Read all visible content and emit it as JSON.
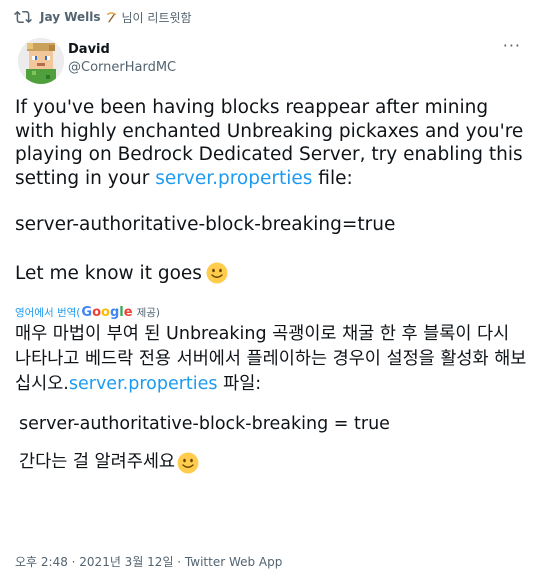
{
  "retweet": {
    "icon": "retweet-icon",
    "user": "Jay Wells",
    "user_emoji": "pickaxe-icon",
    "suffix": "님이 리트윗함"
  },
  "author": {
    "avatar": "minecraft-avatar",
    "name": "David",
    "handle": "@CornerHardMC"
  },
  "more_label": "···",
  "tweet": {
    "p1_before": "If you've been having blocks reappear after mining with highly enchanted Unbreaking pickaxes and you're playing on Bedrock Dedicated Server, try enabling this setting in your ",
    "p1_link": "server.properties",
    "p1_after": " file:",
    "code": "server-authoritative-block-breaking=true",
    "closing": "Let me know it goes",
    "closing_emoji": "slightly-smiling-face-icon"
  },
  "translation": {
    "prefix": "영어에서 번역(",
    "google": "Google",
    "provider": "제공)"
  },
  "translated": {
    "p1_before": "매우 마법이 부여 된 Unbreaking 곡괭이로 채굴 한 후 블록이 다시 나타나고 베드락 전용 서버에서 플레이하는 경우이 설정을 활성화 해보십시오.",
    "p1_link": "server.properties",
    "p1_after": " 파일:",
    "code": "server-authoritative-block-breaking = true",
    "closing": "간다는 걸 알려주세요"
  },
  "footer": {
    "text": "오후 2:48 · 2021년 3월 12일 · Twitter Web App"
  },
  "colors": {
    "link": "#1d9bf0",
    "secondary_text": "#536471",
    "primary_text": "#0f1419"
  }
}
